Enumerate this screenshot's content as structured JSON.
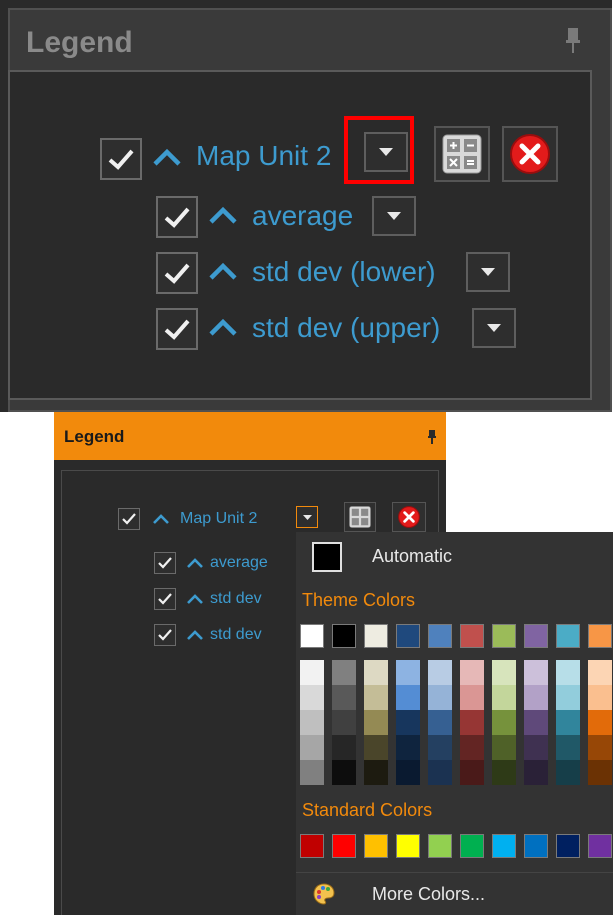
{
  "top": {
    "title": "Legend",
    "root_label": "Map Unit 2",
    "children": [
      "average",
      "std dev (lower)",
      "std dev (upper)"
    ]
  },
  "bottom": {
    "title": "Legend",
    "root_label": "Map Unit 2",
    "children": [
      "average",
      "std dev",
      "std dev"
    ]
  },
  "menu": {
    "automatic_label": "Automatic",
    "theme_colors_label": "Theme Colors",
    "standard_colors_label": "Standard Colors",
    "more_colors_label": "More Colors...",
    "theme_top_row": [
      "#ffffff",
      "#000000",
      "#eeece1",
      "#1f497d",
      "#4f81bd",
      "#c0504d",
      "#9bbb59",
      "#8064a2",
      "#4bacc6",
      "#f79646"
    ],
    "theme_shades": [
      [
        "#f2f2f2",
        "#d9d9d9",
        "#bfbfbf",
        "#a6a6a6",
        "#808080"
      ],
      [
        "#808080",
        "#595959",
        "#404040",
        "#262626",
        "#0d0d0d"
      ],
      [
        "#ddd9c3",
        "#c4bd97",
        "#948a54",
        "#4a452a",
        "#1d1b10"
      ],
      [
        "#8db3e2",
        "#548dd4",
        "#17365d",
        "#0f243e",
        "#0a1a30"
      ],
      [
        "#b8cce4",
        "#95b3d7",
        "#366092",
        "#244061",
        "#1b3251"
      ],
      [
        "#e6b8b7",
        "#da9694",
        "#963634",
        "#632523",
        "#4a1a19"
      ],
      [
        "#d7e4bc",
        "#c3d69b",
        "#76923c",
        "#4f6128",
        "#2e3a17"
      ],
      [
        "#ccc0da",
        "#b2a1c7",
        "#5f497a",
        "#3f3151",
        "#2a2137"
      ],
      [
        "#b7dee8",
        "#92cddc",
        "#31859c",
        "#205867",
        "#163e49"
      ],
      [
        "#fcd5b4",
        "#fabf8f",
        "#e26b0a",
        "#974706",
        "#6b3204"
      ]
    ],
    "standard_colors": [
      "#c00000",
      "#ff0000",
      "#ffc000",
      "#ffff00",
      "#92d050",
      "#00b050",
      "#00b0f0",
      "#0070c0",
      "#002060",
      "#7030a0"
    ]
  }
}
